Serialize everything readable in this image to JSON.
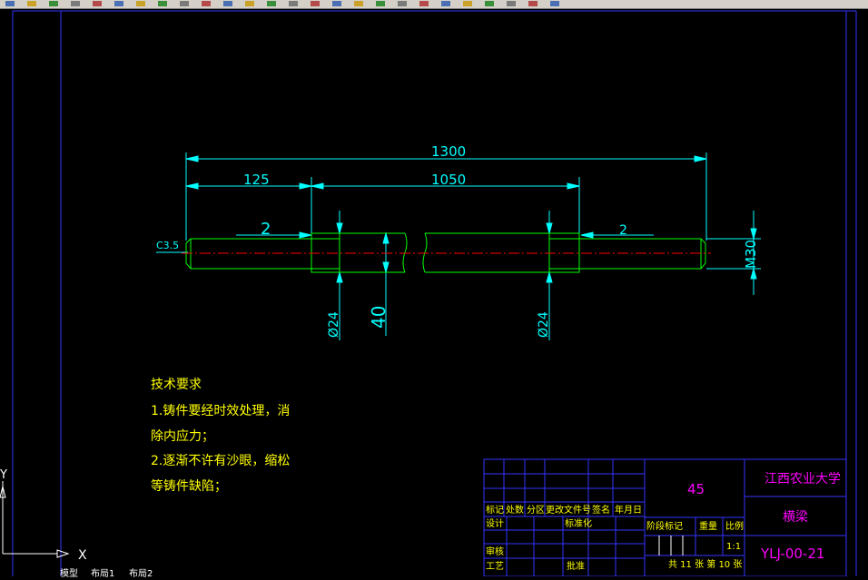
{
  "colors": {
    "background": "#000000",
    "frame": "#3333ff",
    "dimension": "#00ffff",
    "part": "#00ff00",
    "centerline": "#ff0000",
    "notes": "#ffff00",
    "titleblock_text": "#ff00ff",
    "white": "#ffffff"
  },
  "toolbar": {
    "icons": [
      "new-icon",
      "open-icon",
      "save-icon",
      "print-icon",
      "preview-icon",
      "cut-icon",
      "copy-icon",
      "paste-icon",
      "match-icon",
      "undo-icon",
      "redo-icon",
      "pan-icon",
      "zoom-realtime-icon",
      "zoom-window-icon",
      "zoom-previous-icon",
      "properties-icon",
      "design-center-icon",
      "tool-palette-icon",
      "calculator-icon",
      "help-icon",
      "layer-icon",
      "layer-state-icon",
      "bulb-icon",
      "sun-icon",
      "lock-icon",
      "color-icon"
    ]
  },
  "drawing": {
    "dimensions": {
      "overall_length": "1300",
      "left_segment": "125",
      "middle_segment": "1050",
      "chamfer": "C3.5",
      "left_gap": "2",
      "right_gap": "2",
      "thread": "M30",
      "dia_left": "Ø24",
      "dia_center": "40",
      "dia_right": "Ø24"
    },
    "tech_notes": {
      "title": "技术要求",
      "line1": "1.铸件要经时效处理，消",
      "line2": "除内应力；",
      "line3": "2.逐渐不许有沙眼，缩松",
      "line4": "等铸件缺陷；"
    },
    "title_block": {
      "material": "45",
      "university": "江西农业大学",
      "part_name": "横梁",
      "drawing_no": "YLJ-00-21",
      "scale": "1:1",
      "sheets": "共 11 张 第 10 张",
      "headers": {
        "mark": "标记",
        "count": "处数",
        "zone": "分区",
        "change_doc": "更改文件号",
        "signature": "签名",
        "date": "年月日",
        "design": "设计",
        "standardize": "标准化",
        "review": "审核",
        "process": "工艺",
        "approve": "批准",
        "stage_mark": "阶段标记",
        "weight": "重量",
        "scale_label": "比例"
      }
    },
    "ucs": {
      "x_label": "X",
      "y_label": "Y"
    }
  },
  "tabs": {
    "model": "模型",
    "layout1": "布局1",
    "layout2": "布局2"
  }
}
